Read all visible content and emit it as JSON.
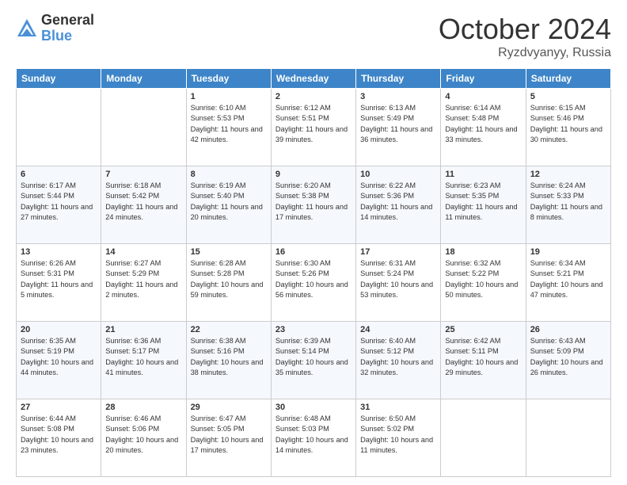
{
  "logo": {
    "general": "General",
    "blue": "Blue"
  },
  "header": {
    "month": "October 2024",
    "location": "Ryzdvyanyy, Russia"
  },
  "days_of_week": [
    "Sunday",
    "Monday",
    "Tuesday",
    "Wednesday",
    "Thursday",
    "Friday",
    "Saturday"
  ],
  "weeks": [
    [
      {
        "day": "",
        "info": ""
      },
      {
        "day": "",
        "info": ""
      },
      {
        "day": "1",
        "info": "Sunrise: 6:10 AM\nSunset: 5:53 PM\nDaylight: 11 hours and 42 minutes."
      },
      {
        "day": "2",
        "info": "Sunrise: 6:12 AM\nSunset: 5:51 PM\nDaylight: 11 hours and 39 minutes."
      },
      {
        "day": "3",
        "info": "Sunrise: 6:13 AM\nSunset: 5:49 PM\nDaylight: 11 hours and 36 minutes."
      },
      {
        "day": "4",
        "info": "Sunrise: 6:14 AM\nSunset: 5:48 PM\nDaylight: 11 hours and 33 minutes."
      },
      {
        "day": "5",
        "info": "Sunrise: 6:15 AM\nSunset: 5:46 PM\nDaylight: 11 hours and 30 minutes."
      }
    ],
    [
      {
        "day": "6",
        "info": "Sunrise: 6:17 AM\nSunset: 5:44 PM\nDaylight: 11 hours and 27 minutes."
      },
      {
        "day": "7",
        "info": "Sunrise: 6:18 AM\nSunset: 5:42 PM\nDaylight: 11 hours and 24 minutes."
      },
      {
        "day": "8",
        "info": "Sunrise: 6:19 AM\nSunset: 5:40 PM\nDaylight: 11 hours and 20 minutes."
      },
      {
        "day": "9",
        "info": "Sunrise: 6:20 AM\nSunset: 5:38 PM\nDaylight: 11 hours and 17 minutes."
      },
      {
        "day": "10",
        "info": "Sunrise: 6:22 AM\nSunset: 5:36 PM\nDaylight: 11 hours and 14 minutes."
      },
      {
        "day": "11",
        "info": "Sunrise: 6:23 AM\nSunset: 5:35 PM\nDaylight: 11 hours and 11 minutes."
      },
      {
        "day": "12",
        "info": "Sunrise: 6:24 AM\nSunset: 5:33 PM\nDaylight: 11 hours and 8 minutes."
      }
    ],
    [
      {
        "day": "13",
        "info": "Sunrise: 6:26 AM\nSunset: 5:31 PM\nDaylight: 11 hours and 5 minutes."
      },
      {
        "day": "14",
        "info": "Sunrise: 6:27 AM\nSunset: 5:29 PM\nDaylight: 11 hours and 2 minutes."
      },
      {
        "day": "15",
        "info": "Sunrise: 6:28 AM\nSunset: 5:28 PM\nDaylight: 10 hours and 59 minutes."
      },
      {
        "day": "16",
        "info": "Sunrise: 6:30 AM\nSunset: 5:26 PM\nDaylight: 10 hours and 56 minutes."
      },
      {
        "day": "17",
        "info": "Sunrise: 6:31 AM\nSunset: 5:24 PM\nDaylight: 10 hours and 53 minutes."
      },
      {
        "day": "18",
        "info": "Sunrise: 6:32 AM\nSunset: 5:22 PM\nDaylight: 10 hours and 50 minutes."
      },
      {
        "day": "19",
        "info": "Sunrise: 6:34 AM\nSunset: 5:21 PM\nDaylight: 10 hours and 47 minutes."
      }
    ],
    [
      {
        "day": "20",
        "info": "Sunrise: 6:35 AM\nSunset: 5:19 PM\nDaylight: 10 hours and 44 minutes."
      },
      {
        "day": "21",
        "info": "Sunrise: 6:36 AM\nSunset: 5:17 PM\nDaylight: 10 hours and 41 minutes."
      },
      {
        "day": "22",
        "info": "Sunrise: 6:38 AM\nSunset: 5:16 PM\nDaylight: 10 hours and 38 minutes."
      },
      {
        "day": "23",
        "info": "Sunrise: 6:39 AM\nSunset: 5:14 PM\nDaylight: 10 hours and 35 minutes."
      },
      {
        "day": "24",
        "info": "Sunrise: 6:40 AM\nSunset: 5:12 PM\nDaylight: 10 hours and 32 minutes."
      },
      {
        "day": "25",
        "info": "Sunrise: 6:42 AM\nSunset: 5:11 PM\nDaylight: 10 hours and 29 minutes."
      },
      {
        "day": "26",
        "info": "Sunrise: 6:43 AM\nSunset: 5:09 PM\nDaylight: 10 hours and 26 minutes."
      }
    ],
    [
      {
        "day": "27",
        "info": "Sunrise: 6:44 AM\nSunset: 5:08 PM\nDaylight: 10 hours and 23 minutes."
      },
      {
        "day": "28",
        "info": "Sunrise: 6:46 AM\nSunset: 5:06 PM\nDaylight: 10 hours and 20 minutes."
      },
      {
        "day": "29",
        "info": "Sunrise: 6:47 AM\nSunset: 5:05 PM\nDaylight: 10 hours and 17 minutes."
      },
      {
        "day": "30",
        "info": "Sunrise: 6:48 AM\nSunset: 5:03 PM\nDaylight: 10 hours and 14 minutes."
      },
      {
        "day": "31",
        "info": "Sunrise: 6:50 AM\nSunset: 5:02 PM\nDaylight: 10 hours and 11 minutes."
      },
      {
        "day": "",
        "info": ""
      },
      {
        "day": "",
        "info": ""
      }
    ]
  ]
}
